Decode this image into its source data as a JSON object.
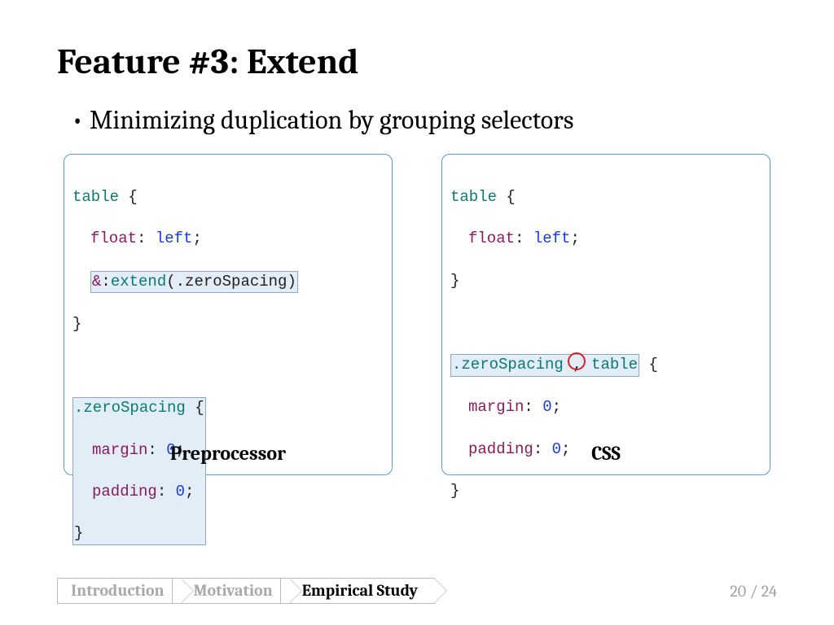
{
  "title": "Feature #3: Extend",
  "bullet": "Minimizing duplication by grouping selectors",
  "left": {
    "label": "Preprocessor",
    "line1_sel": "table",
    "line1_brace": " {",
    "line2_prop": "float",
    "line2_colon": ": ",
    "line2_val": "left",
    "line2_semi": ";",
    "line3_amp": "&",
    "line3_colon": ":",
    "line3_ext": "extend",
    "line3_paren1": "(",
    "line3_arg": ".zeroSpacing",
    "line3_paren2": ")",
    "line4_close": "}",
    "blk_line1_sel": ".zeroSpacing",
    "blk_line1_brace": " {",
    "blk_line2_prop": "margin",
    "blk_line2_colon": ": ",
    "blk_line2_val": "0",
    "blk_line2_semi": ";",
    "blk_line3_prop": "padding",
    "blk_line3_colon": ": ",
    "blk_line3_val": "0",
    "blk_line3_semi": ";",
    "blk_line4_close": "}"
  },
  "right": {
    "label": "CSS",
    "line1_sel": "table",
    "line1_brace": " {",
    "line2_prop": "float",
    "line2_colon": ": ",
    "line2_val": "left",
    "line2_semi": ";",
    "line3_close": "}",
    "grp_a": ".zeroSpacing ",
    "grp_comma": ",",
    "grp_b": " table",
    "grp_brace": " {",
    "grp_l2_prop": "margin",
    "grp_l2_colon": ": ",
    "grp_l2_val": "0",
    "grp_l2_semi": ";",
    "grp_l3_prop": "padding",
    "grp_l3_colon": ": ",
    "grp_l3_val": "0",
    "grp_l3_semi": ";",
    "grp_close": "}"
  },
  "breadcrumbs": [
    "Introduction",
    "Motivation",
    "Empirical Study"
  ],
  "page": "20 / 24"
}
